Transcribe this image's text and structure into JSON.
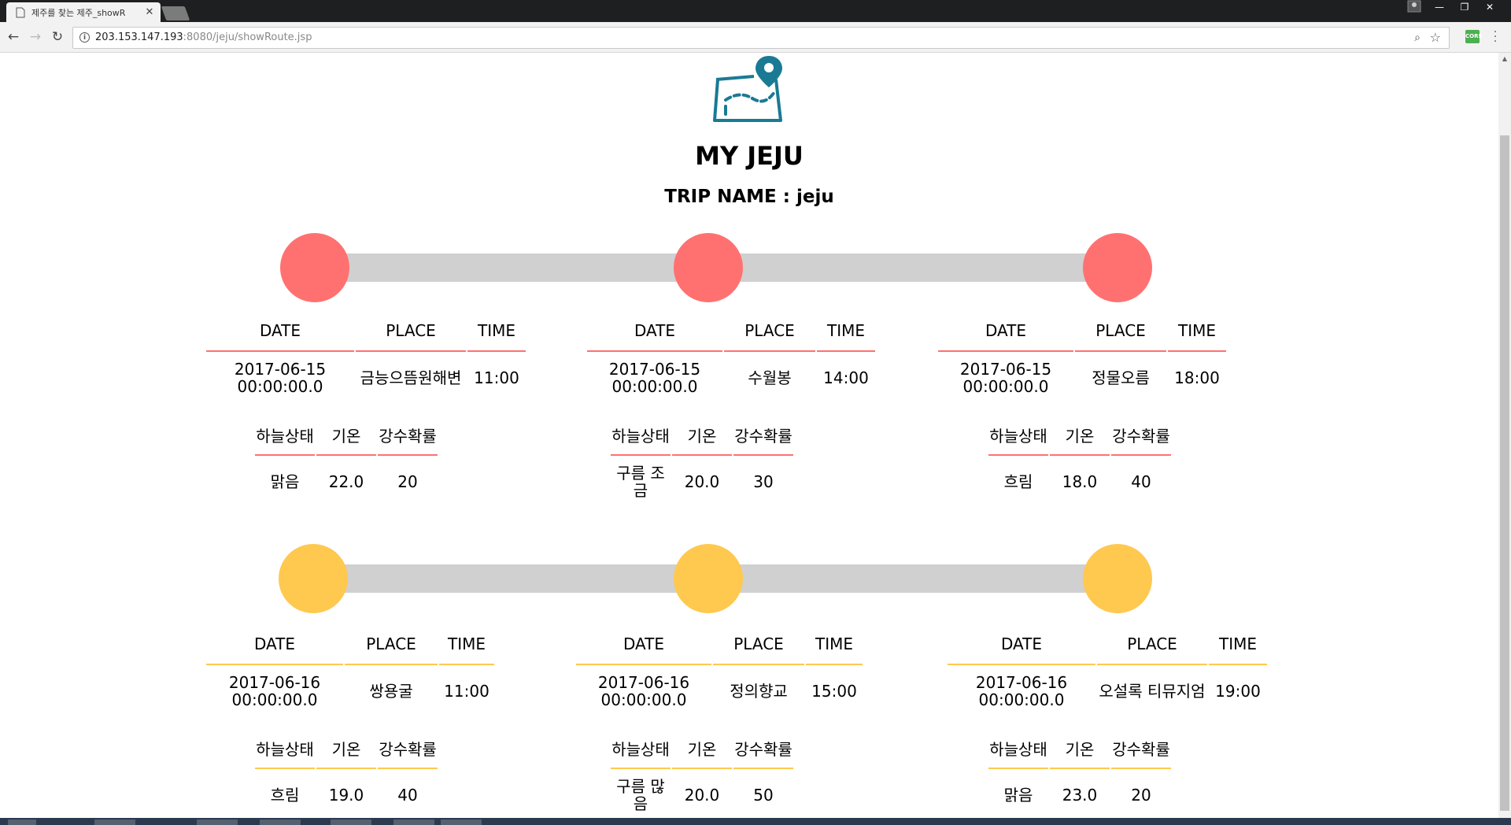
{
  "browser": {
    "tab_title": "제주를 찾는 제주_showR",
    "tab_close": "✕",
    "url_host": "203.153.147.193",
    "url_rest": ":8080/jeju/showRoute.jsp",
    "extension_label": "CORS",
    "window_controls": [
      "—",
      "❐",
      "✕"
    ]
  },
  "page": {
    "title": "MY JEJU",
    "trip_name": "TRIP NAME : jeju"
  },
  "headers": {
    "date": "DATE",
    "place": "PLACE",
    "time": "TIME",
    "sky": "하늘상태",
    "temp": "기온",
    "rain": "강수확률"
  },
  "colors": {
    "day1": "#ff7170",
    "day2": "#ffc84f",
    "bar": "#d0d0d0",
    "logo": "#1a7a94"
  },
  "stops": [
    {
      "date": "2017-06-15 00:00:00.0",
      "place": "금능으뜸원해변",
      "time": "11:00",
      "sky": "맑음",
      "temp": "22.0",
      "rain": "20"
    },
    {
      "date": "2017-06-15 00:00:00.0",
      "place": "수월봉",
      "time": "14:00",
      "sky": "구름 조금",
      "temp": "20.0",
      "rain": "30"
    },
    {
      "date": "2017-06-15 00:00:00.0",
      "place": "정물오름",
      "time": "18:00",
      "sky": "흐림",
      "temp": "18.0",
      "rain": "40"
    },
    {
      "date": "2017-06-16 00:00:00.0",
      "place": "쌍용굴",
      "time": "11:00",
      "sky": "흐림",
      "temp": "19.0",
      "rain": "40"
    },
    {
      "date": "2017-06-16 00:00:00.0",
      "place": "정의향교",
      "time": "15:00",
      "sky": "구름 많음",
      "temp": "20.0",
      "rain": "50"
    },
    {
      "date": "2017-06-16 00:00:00.0",
      "place": "오설록 티뮤지엄",
      "time": "19:00",
      "sky": "맑음",
      "temp": "23.0",
      "rain": "20"
    }
  ]
}
